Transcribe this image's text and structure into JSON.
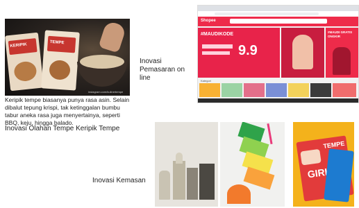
{
  "slide": {
    "product_photo_caption": "Keripik tempe biasanya punya rasa asin. Selain dibalut tepung krispi, tak ketinggalan bumbu tabur aneka rasa juga menyertainya, seperti BBQ, keju, hingga balado.",
    "product_photo_watermark": "instagram.com/kulinertempe",
    "label_olahan": "Inovasi Olahan Tempe Keripik Tempe",
    "label_pemasaran": "Inovasi Pemasaran on line",
    "label_kemasan": "Inovasi Kemasan",
    "bag_brand_text": "KERIPIK",
    "bag_brand_text_2": "TEMPE",
    "shop": {
      "logo": "Shopee",
      "headline": "#MAUDIKODE",
      "big_number": "9.9",
      "right_promo": "#MAUDI GRATIS ONGKIR",
      "section_title": "Kategori"
    },
    "tempe_box_text_1": "TEMPE",
    "tempe_box_text_2": "GIRL",
    "colors": {
      "shop_red": "#ee2b4a",
      "dark_bg": "#1c1a1a",
      "yellow_bg": "#f4b21b"
    }
  }
}
